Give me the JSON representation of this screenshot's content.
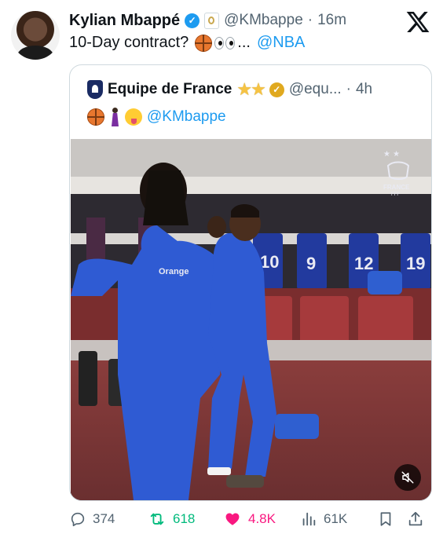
{
  "tweet": {
    "author_name": "Kylian Mbappé",
    "verified_icon": "verified-badge-icon",
    "affiliate_icon": "real-madrid-badge-icon",
    "handle": "@KMbappe",
    "separator": "·",
    "time": "16m",
    "text_prefix": "10-Day contract?",
    "text_ellipsis": "...",
    "mention": "@NBA",
    "avatar_icon": "profile-photo",
    "brand_icon": "x-logo-icon"
  },
  "quote": {
    "author_name": "Equipe de France",
    "badge_icon": "fff-crest-icon",
    "emoji_icons": [
      "star-emoji",
      "star-emoji"
    ],
    "verified_icon": "gold-verified-badge-icon",
    "handle": "@equ...",
    "separator": "·",
    "time": "4h",
    "text_emojis": [
      "basketball-emoji",
      "dancing-person-emoji",
      "tongue-face-emoji"
    ],
    "mention": "@KMbappe",
    "video": {
      "watermark_text": "FRANCE",
      "watermark_sub": "FFF",
      "mute_icon": "muted-speaker-icon",
      "jersey_numbers": [
        "10",
        "9",
        "12",
        "19"
      ],
      "shirt_text": "Orange"
    }
  },
  "actions": {
    "replies": "374",
    "reposts": "618",
    "likes": "4.8K",
    "views": "61K",
    "colors": {
      "repost": "#00ba7c",
      "like": "#f91880",
      "muted": "#536471",
      "link": "#1d9bf0"
    }
  }
}
